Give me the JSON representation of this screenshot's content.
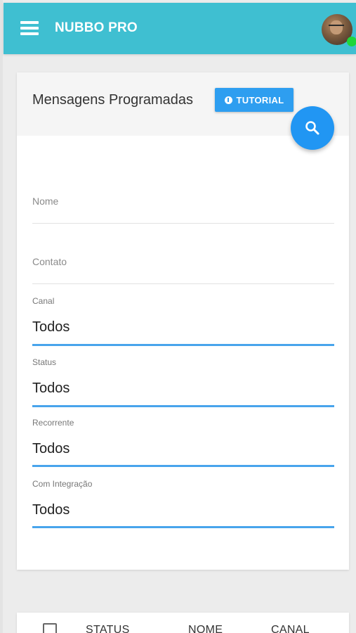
{
  "app": {
    "title": "NUBBO PRO",
    "accent_color": "#3fbfd1",
    "menu_icon": "hamburger-menu-icon",
    "avatar_status": "online"
  },
  "card": {
    "title": "Mensagens Programadas",
    "tutorial_label": "TUTORIAL",
    "tutorial_icon": "info-icon",
    "search_icon": "search-icon",
    "button_color": "#2196f3"
  },
  "filters": {
    "nome_placeholder": "Nome",
    "contato_placeholder": "Contato",
    "canal_label": "Canal",
    "canal_value": "Todos",
    "status_label": "Status",
    "status_value": "Todos",
    "recorrente_label": "Recorrente",
    "recorrente_value": "Todos",
    "integracao_label": "Com Integração",
    "integracao_value": "Todos"
  },
  "table": {
    "columns": [
      "STATUS",
      "NOME",
      "CANAL"
    ]
  }
}
